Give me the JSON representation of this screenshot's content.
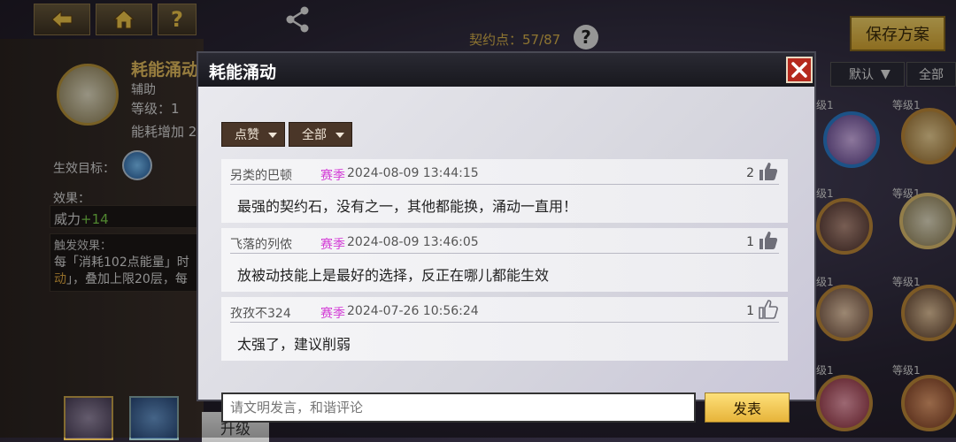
{
  "nav": {
    "back_icon": "back-arrow-icon",
    "home_icon": "home-icon",
    "help_label": "?",
    "share_icon": "share-icon"
  },
  "header": {
    "contract_points": "契约点：57/87",
    "help_label": "?",
    "save_label": "保存方案"
  },
  "item": {
    "name": "耗能涌动",
    "type": "辅助",
    "level": "等级：1",
    "energy": "能耗增加 2",
    "target_label": "生效目标：",
    "effect_label": "效果：",
    "effect_name": "威力",
    "effect_value": "+14",
    "trigger_label": "触发效果：",
    "trigger_text_1": "每「消耗102点能量」时",
    "trigger_text_2a": "动",
    "trigger_text_2b": "」，叠加上限20层，每"
  },
  "bottom": {
    "upgrade_label": "升级"
  },
  "right": {
    "sort_label": "默认",
    "filter_label": "全部",
    "level_labels": [
      "级1",
      "等级1",
      "级1",
      "等级1",
      "级1",
      "等级1",
      "级1",
      "等级1"
    ]
  },
  "modal": {
    "title": "耗能涌动",
    "filter_sort": "点赞",
    "filter_scope": "全部",
    "comments": [
      {
        "user": "另类的巴顿",
        "season": "赛季",
        "time": "2024-08-09  13:44:15",
        "likes": "2",
        "liked": true,
        "text": "最强的契约石，没有之一，其他都能换，涌动一直用！"
      },
      {
        "user": "飞落的列侬",
        "season": "赛季",
        "time": "2024-08-09  13:46:05",
        "likes": "1",
        "liked": true,
        "text": "放被动技能上是最好的选择，反正在哪儿都能生效"
      },
      {
        "user": "孜孜不324",
        "season": "赛季",
        "time": "2024-07-26  10:56:24",
        "likes": "1",
        "liked": false,
        "text": "太强了，建议削弱"
      }
    ],
    "input_placeholder": "请文明发言，和谐评论",
    "post_label": "发表"
  },
  "colors": {
    "accent_gold": "#e7b43a",
    "season_pink": "#d33cd6",
    "close_red": "#b52a1e"
  }
}
